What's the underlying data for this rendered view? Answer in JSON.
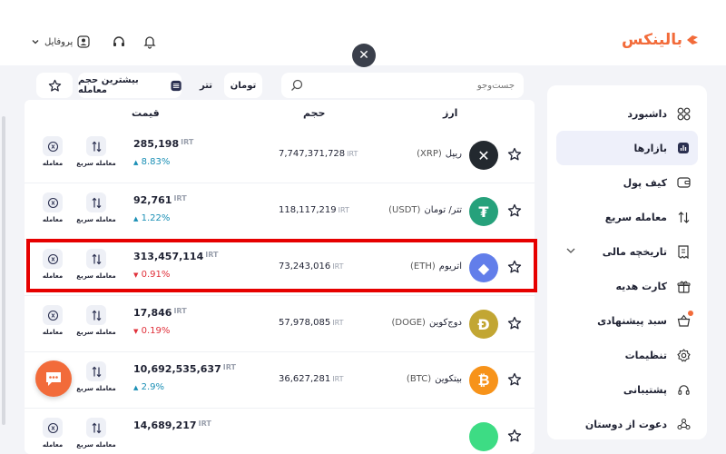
{
  "brand": {
    "name": "بالینکس",
    "color": "#f26b3a"
  },
  "header": {
    "profile_label": "پروفایل",
    "icons": [
      "chevron-down-icon",
      "user-icon",
      "headset-icon",
      "bell-icon"
    ]
  },
  "sidebar": {
    "items": [
      {
        "label": "داشبورد",
        "icon": "grid-icon",
        "active": false
      },
      {
        "label": "بازارها",
        "icon": "chart-icon",
        "active": true
      },
      {
        "label": "کیف پول",
        "icon": "wallet-icon",
        "active": false
      },
      {
        "label": "معامله سریع",
        "icon": "swap-icon",
        "active": false
      },
      {
        "label": "تاریخچه مالی",
        "icon": "receipt-icon",
        "active": false
      },
      {
        "label": "کارت هدیه",
        "icon": "gift-icon",
        "active": false
      },
      {
        "label": "سبد پیشنهادی",
        "icon": "basket-icon",
        "active": false
      },
      {
        "label": "تنظیمات",
        "icon": "gear-icon",
        "active": false
      },
      {
        "label": "پشتیبانی",
        "icon": "headset-icon",
        "active": false
      },
      {
        "label": "دعوت از دوستان",
        "icon": "users-icon",
        "active": false
      }
    ]
  },
  "filters": {
    "search_placeholder": "جست‌وجو",
    "toman": "تومان",
    "tether": "تتر",
    "most_volume": "بیشترین حجم معامله"
  },
  "table": {
    "headers": {
      "coin": "ارز",
      "volume": "حجم",
      "price": "قیمت"
    },
    "unit": "IRT",
    "quick_trade_label": "معامله سریع",
    "trade_label": "معامله",
    "rows": [
      {
        "name": "ریپل",
        "symbol": "(XRP)",
        "volume": "7,747,371,728",
        "price": "285,198",
        "change": "8.83%",
        "direction": "up",
        "logo_color": "#23292f",
        "logo_glyph": "✕"
      },
      {
        "name": "تتر/ تومان",
        "symbol": "(USDT)",
        "volume": "118,117,219",
        "price": "92,761",
        "change": "1.22%",
        "direction": "up",
        "logo_color": "#26a17b",
        "logo_glyph": "₮"
      },
      {
        "name": "اتریوم",
        "symbol": "(ETH)",
        "volume": "73,243,016",
        "price": "313,457,114",
        "change": "0.91%",
        "direction": "down",
        "logo_color": "#627eea",
        "logo_glyph": "◆"
      },
      {
        "name": "دوج‌کوین",
        "symbol": "(DOGE)",
        "volume": "57,978,085",
        "price": "17,846",
        "change": "0.19%",
        "direction": "down",
        "logo_color": "#c2a633",
        "logo_glyph": "Ð"
      },
      {
        "name": "بیتکوین",
        "symbol": "(BTC)",
        "volume": "36,627,281",
        "price": "10,692,535,637",
        "change": "2.9%",
        "direction": "up",
        "logo_color": "#f7931a",
        "logo_glyph": "₿"
      },
      {
        "name": "",
        "symbol": "",
        "volume": "",
        "price": "14,689,217",
        "change": "",
        "direction": "up",
        "logo_color": "#3ddc84",
        "logo_glyph": ""
      }
    ]
  },
  "highlighted_row": 2,
  "colors": {
    "up": "#1a8fb5",
    "down": "#e0303a",
    "highlight": "#e60000",
    "active_bg": "#eef0fa"
  }
}
